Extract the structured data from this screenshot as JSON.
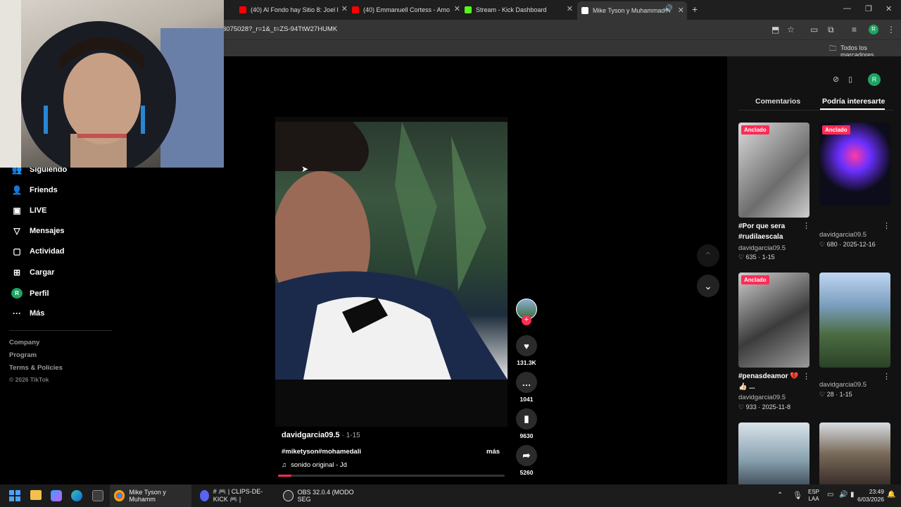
{
  "browser": {
    "tabs": [
      {
        "label": "(40) Al Fondo hay Sitio 8: Joel l",
        "fav_color": "#ff0000"
      },
      {
        "label": "(40) Emmanuell Cortess - Amo",
        "fav_color": "#ff0000"
      },
      {
        "label": "Stream - Kick Dashboard",
        "fav_color": "#53fc18"
      },
      {
        "label": "Mike Tyson y Muhammad A",
        "fav_color": "#ffffff"
      }
    ],
    "new_tab": "+",
    "url": "3075028?_r=1&_t=ZS-94TtW27HUMK",
    "bookmarks_label": "Todos los marcadores",
    "profile_initial": "R"
  },
  "sidebar": {
    "items": [
      {
        "label": "Siguiendo",
        "icon": "people-icon",
        "glyph": "👥"
      },
      {
        "label": "Friends",
        "icon": "friends-icon",
        "glyph": "👤"
      },
      {
        "label": "LIVE",
        "icon": "live-icon",
        "glyph": "▣"
      },
      {
        "label": "Mensajes",
        "icon": "messages-icon",
        "glyph": "▽"
      },
      {
        "label": "Actividad",
        "icon": "activity-icon",
        "glyph": "▢"
      },
      {
        "label": "Cargar",
        "icon": "upload-icon",
        "glyph": "⊞"
      },
      {
        "label": "Perfil",
        "icon": "profile-icon",
        "glyph": "R"
      },
      {
        "label": "Más",
        "icon": "more-icon",
        "glyph": "···"
      }
    ],
    "footer": [
      "Company",
      "Program",
      "Terms & Policies",
      "© 2026 TikTok"
    ]
  },
  "video": {
    "author": "davidgarcia09.5",
    "date": "· 1-15",
    "hashtags": "#miketyson#mohamedali",
    "more": "más",
    "sound": "sonido original - Jd",
    "progress": 0.06,
    "actions": [
      {
        "name": "like",
        "glyph": "♥",
        "count": "131.3K"
      },
      {
        "name": "comment",
        "glyph": "…",
        "count": "1041"
      },
      {
        "name": "bookmark",
        "glyph": "▮",
        "count": "9630"
      },
      {
        "name": "share",
        "glyph": "➦",
        "count": "5260"
      }
    ]
  },
  "panel": {
    "tabs": [
      "Comentarios",
      "Podría interesarte"
    ],
    "pinned_label": "Anclado",
    "cards": [
      {
        "title": "#Por que sera #rudilaescala",
        "user": "davidgarcia09.5",
        "likes": "635",
        "date": "1-15",
        "pinned": true
      },
      {
        "title": "",
        "user": "davidgarcia09.5",
        "likes": "680",
        "date": "2025-12-16",
        "pinned": true
      },
      {
        "title": "#penasdeamor 💔 👍🏻 ...",
        "user": "davidgarcia09.5",
        "likes": "933",
        "date": "2025-11-8",
        "pinned": true
      },
      {
        "title": "",
        "user": "davidgarcia09.5",
        "likes": "28",
        "date": "1-15",
        "pinned": false
      }
    ]
  },
  "taskbar": {
    "apps": [
      {
        "label": "Mike Tyson y Muhamm",
        "color": "#4285f4"
      },
      {
        "label": "# 🎮 | CLIPS-DE-KICK 🎮 |",
        "color": "#5865f2"
      },
      {
        "label": "OBS 32.0.4 (MODO SEG",
        "color": "#302e31"
      }
    ],
    "lang_top": "ESP",
    "lang_bottom": "LAA",
    "time": "23:49",
    "date": "6/03/2026"
  }
}
